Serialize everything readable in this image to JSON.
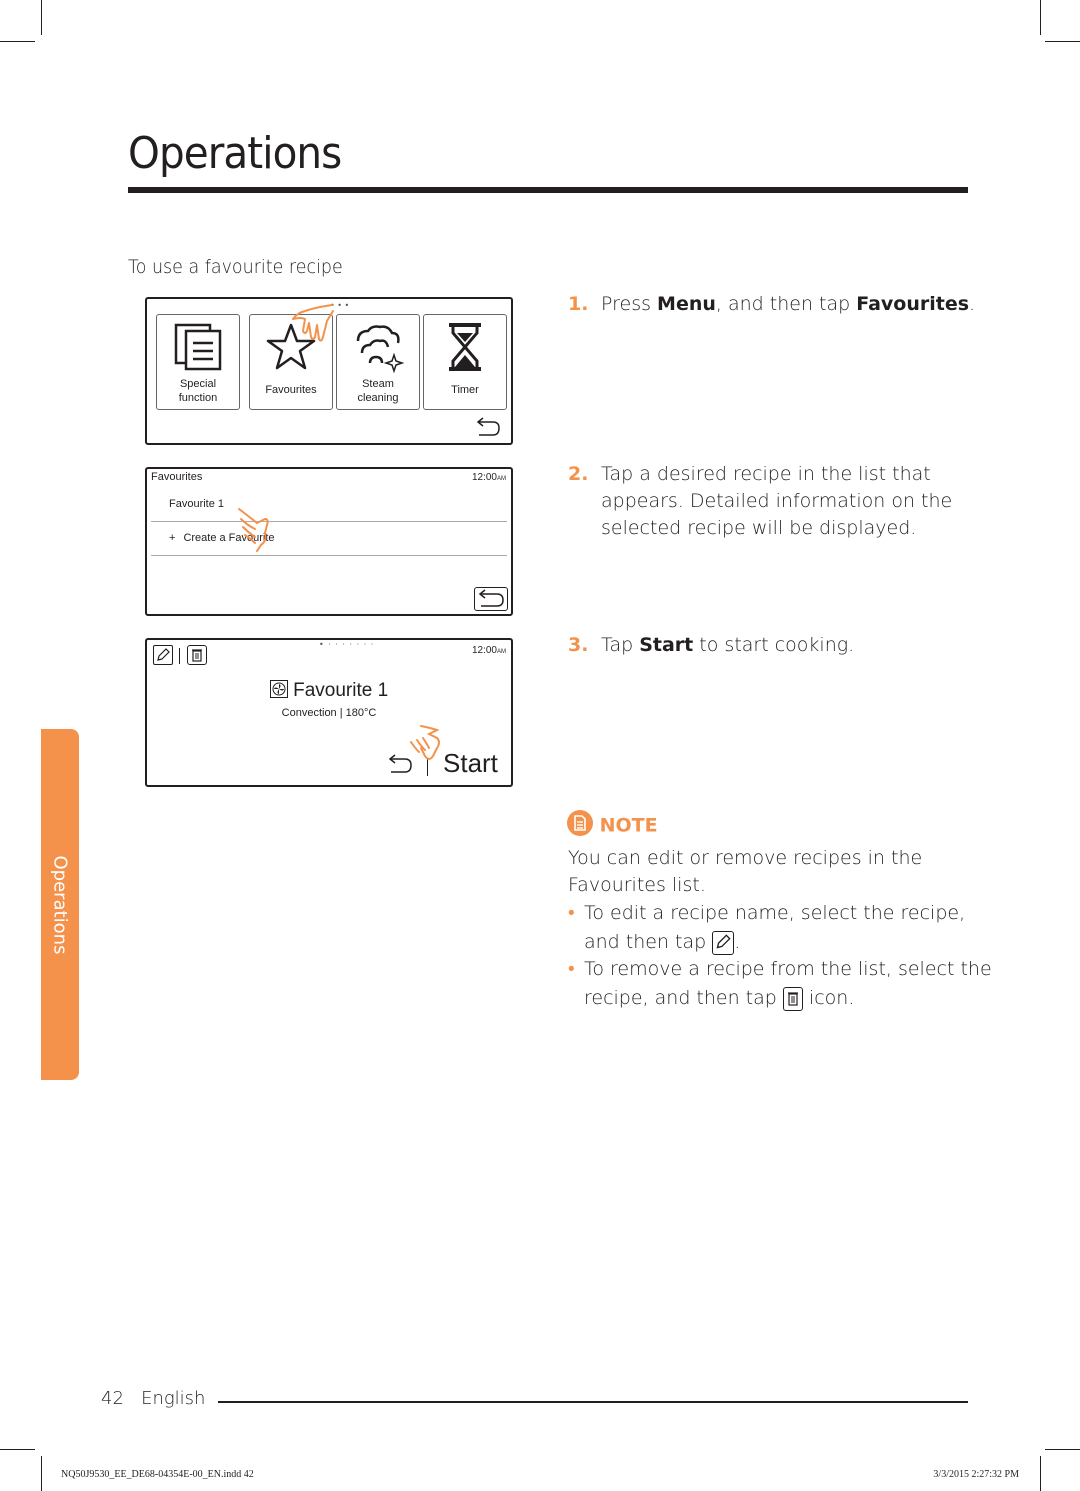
{
  "page": {
    "title": "Operations",
    "section_heading": "To use a favourite recipe",
    "side_tab_label": "Operations",
    "page_number": "42",
    "language": "English",
    "slug_file": "NQ50J9530_EE_DE68-04354E-00_EN.indd   42",
    "slug_date": "3/3/2015   2:27:32 PM",
    "accent_color": "#f4924b"
  },
  "screen1": {
    "tiles": [
      {
        "label_line1": "Special",
        "label_line2": "function",
        "icon": "special-function-icon"
      },
      {
        "label_line1": "Favourites",
        "label_line2": "",
        "icon": "star-icon"
      },
      {
        "label_line1": "Steam",
        "label_line2": "cleaning",
        "icon": "steam-cleaning-icon"
      },
      {
        "label_line1": "Timer",
        "label_line2": "",
        "icon": "hourglass-icon"
      }
    ]
  },
  "screen2": {
    "header": "Favourites",
    "time": "12:00",
    "ampm": "AM",
    "items": [
      "Favourite 1",
      "Create a Favourite"
    ],
    "add_symbol": "+"
  },
  "screen3": {
    "time": "12:00",
    "ampm": "AM",
    "recipe_name": "Favourite 1",
    "recipe_detail": "Convection | 180°C",
    "start_label": "Start"
  },
  "steps": [
    {
      "num": "1.",
      "pre": "Press ",
      "b1": "Menu",
      "mid": ", and then tap ",
      "b2": "Favourites",
      "post": "."
    },
    {
      "num": "2.",
      "line1": "Tap a desired recipe in the list that",
      "line2": "appears. Detailed information on the",
      "line3": "selected recipe will be displayed."
    },
    {
      "num": "3.",
      "pre": "Tap ",
      "b1": "Start",
      "post": " to start cooking."
    }
  ],
  "note": {
    "heading": "NOTE",
    "line1": "You can edit or remove recipes in the",
    "line2": "Favourites list.",
    "bullets": [
      {
        "line1": "To edit a recipe name, select the recipe,",
        "line2_pre": "and then tap ",
        "line2_post": "."
      },
      {
        "line1": "To remove a recipe from the list, select the",
        "line2_pre": "recipe, and then tap ",
        "line2_post": " icon."
      }
    ],
    "bullet_char": "•"
  }
}
